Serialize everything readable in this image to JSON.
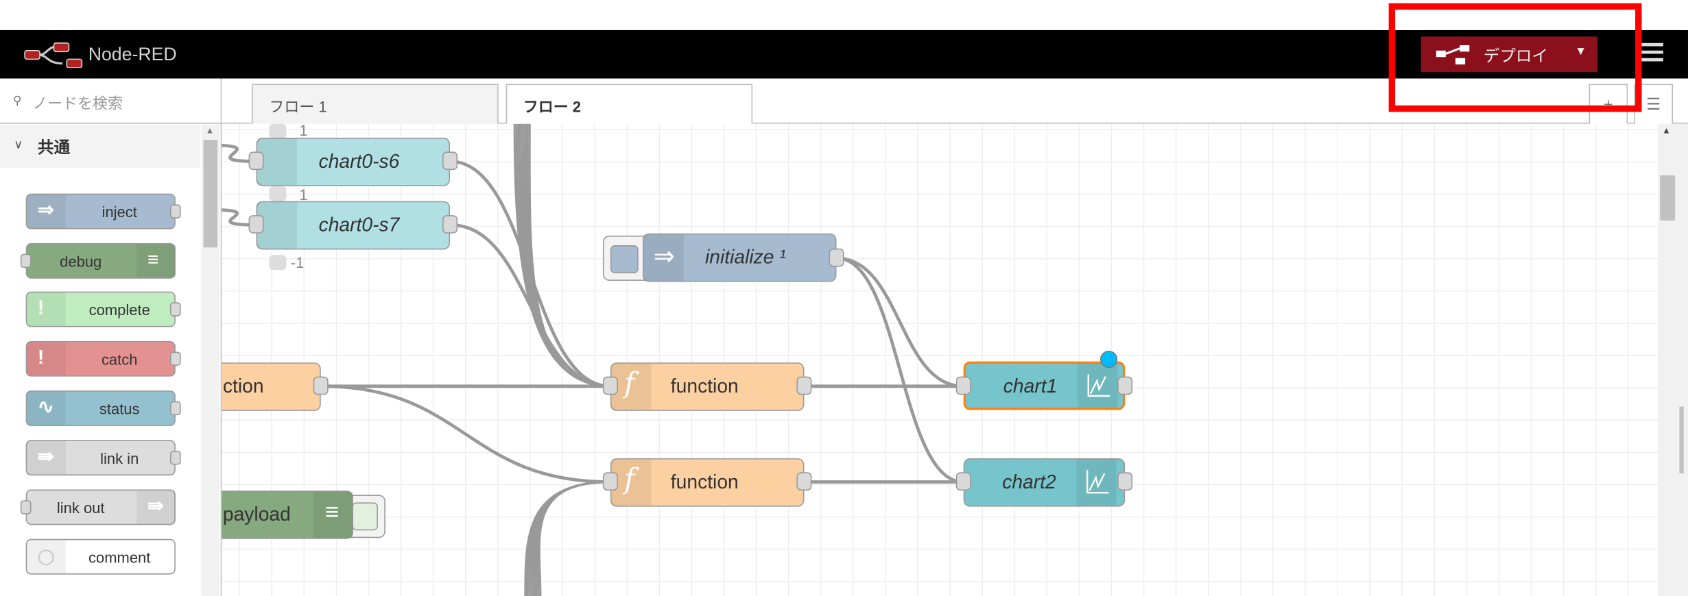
{
  "header": {
    "title": "Node-RED",
    "deploy_label": "デプロイ",
    "deploy_caret": "▼",
    "brand_color": "#8c101c"
  },
  "sidebar": {
    "search_placeholder": "ノードを検索",
    "category": "共通",
    "nodes": [
      {
        "label": "inject",
        "color": "#a6bbcf",
        "icon": "arrow-right-icon"
      },
      {
        "label": "debug",
        "color": "#87a980",
        "icon": "list-icon"
      },
      {
        "label": "complete",
        "color": "#c0edc0",
        "icon": "exclamation-icon"
      },
      {
        "label": "catch",
        "color": "#e49191",
        "icon": "exclamation-icon"
      },
      {
        "label": "status",
        "color": "#94c1d0",
        "icon": "pulse-icon"
      },
      {
        "label": "link in",
        "color": "#dddddd",
        "icon": "link-in-icon"
      },
      {
        "label": "link out",
        "color": "#dddddd",
        "icon": "link-out-icon"
      },
      {
        "label": "comment",
        "color": "#ffffff",
        "icon": "comment-icon"
      }
    ]
  },
  "tabs": [
    {
      "label": "フロー 1",
      "active": false
    },
    {
      "label": "フロー 2",
      "active": true
    }
  ],
  "tab_buttons": {
    "add": "+",
    "list": "☰"
  },
  "workspace": {
    "nodes": {
      "chart0_s6": {
        "label": "chart0-s6",
        "status": "1"
      },
      "chart0_s7": {
        "label": "chart0-s7",
        "status_top": "1",
        "status": "-1"
      },
      "initialize": {
        "label": "initialize ¹"
      },
      "function_partial": {
        "label": "ction"
      },
      "function1": {
        "label": "function"
      },
      "function2": {
        "label": "function"
      },
      "debug_partial": {
        "label": "payload"
      },
      "chart1": {
        "label": "chart1",
        "selected": true,
        "changed": true
      },
      "chart2": {
        "label": "chart2"
      }
    },
    "colors": {
      "function": "#fdd0a2",
      "inject": "#a6bbcf",
      "chart": "#77c5cc",
      "template": "#b0e0e4",
      "debug": "#87a980",
      "selected": "#ff7f0e",
      "changed": "#00bcff"
    }
  }
}
